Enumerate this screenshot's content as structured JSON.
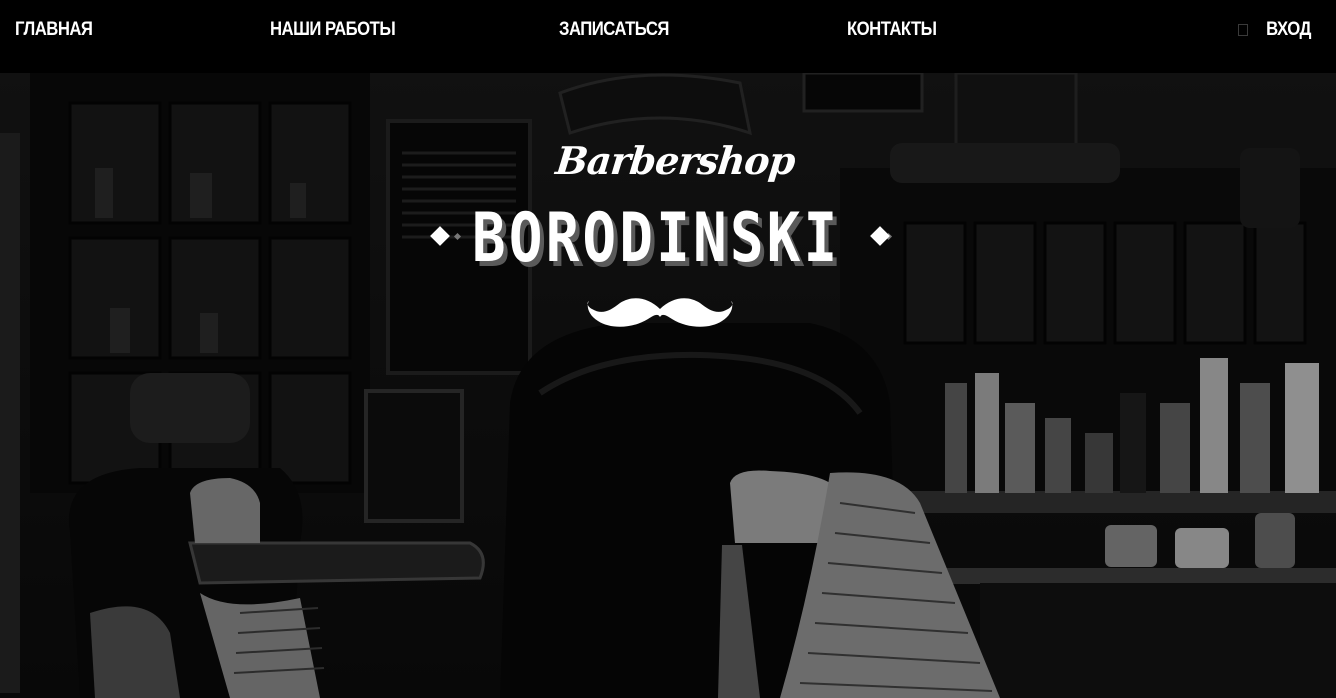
{
  "nav": {
    "items": [
      {
        "label": "ГЛАВНАЯ"
      },
      {
        "label": "НАШИ РАБОТЫ"
      },
      {
        "label": "ЗАПИСАТЬСЯ"
      },
      {
        "label": "КОНТАКТЫ"
      }
    ],
    "login_label": "ВХОД",
    "login_icon": "login-icon"
  },
  "hero": {
    "script_text": "Barbershop",
    "brand_text": "BORODINSKI",
    "emblem_icon": "mustache-icon"
  },
  "colors": {
    "nav_background": "#000000",
    "text": "#ffffff",
    "hero_overlay": "#141414"
  }
}
